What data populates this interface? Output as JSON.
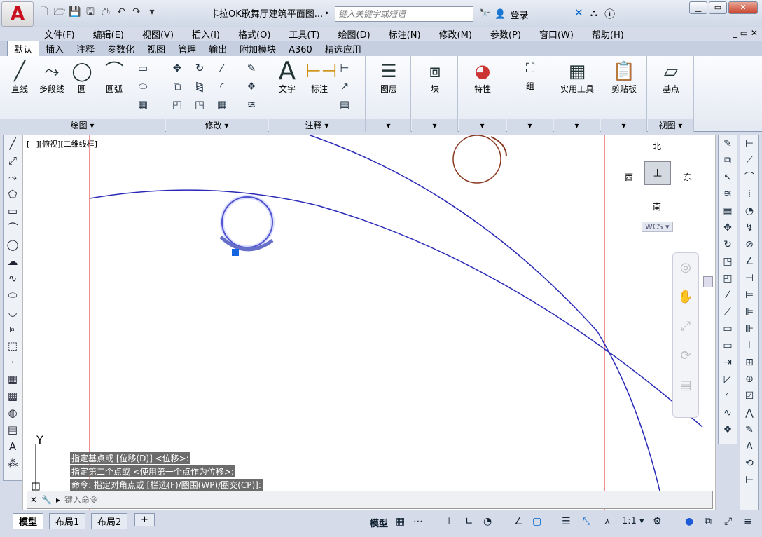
{
  "app": {
    "logo": "A",
    "doc_title": "卡拉OK歌舞厅建筑平面图...",
    "search_placeholder": "键入关键字或短语",
    "login": "登录"
  },
  "qat_icons": [
    "new-icon",
    "open-icon",
    "save-icon",
    "saveas-icon",
    "print-icon",
    "undo-icon",
    "redo-icon",
    "dropdown-icon"
  ],
  "menu": [
    "文件(F)",
    "编辑(E)",
    "视图(V)",
    "插入(I)",
    "格式(O)",
    "工具(T)",
    "绘图(D)",
    "标注(N)",
    "修改(M)",
    "参数(P)",
    "窗口(W)",
    "帮助(H)"
  ],
  "tabs": [
    "默认",
    "插入",
    "注释",
    "参数化",
    "视图",
    "管理",
    "输出",
    "附加模块",
    "A360",
    "精选应用"
  ],
  "ribbon": {
    "draw": {
      "title": "绘图 ▾",
      "line": "直线",
      "polyline": "多段线",
      "circle": "圆",
      "arc": "圆弧"
    },
    "modify": {
      "title": "修改 ▾"
    },
    "annot": {
      "title": "注释 ▾",
      "text": "文字",
      "dim": "标注"
    },
    "layer": "图层",
    "block": "块",
    "props": "特性",
    "group": "组",
    "utils": "实用工具",
    "clipboard": "剪贴板",
    "view": {
      "title": "视图 ▾",
      "base": "基点"
    }
  },
  "viewport": {
    "label": "[−][俯视][二维线框]",
    "north": "北",
    "south": "南",
    "east": "东",
    "west": "西",
    "cube_top": "上",
    "wcs": "WCS ▾",
    "axis_y": "Y"
  },
  "command": {
    "history": [
      "指定基点或 [位移(D)] <位移>:",
      "指定第二个点或 <使用第一个点作为位移>:",
      "命令: 指定对角点或 [栏选(F)/圈围(WP)/圈交(CP)]:"
    ],
    "placeholder": "键入命令"
  },
  "layout_tabs": [
    "模型",
    "布局1",
    "布局2",
    "+"
  ],
  "status": {
    "model": "模型",
    "scale": "1:1 ▾"
  }
}
